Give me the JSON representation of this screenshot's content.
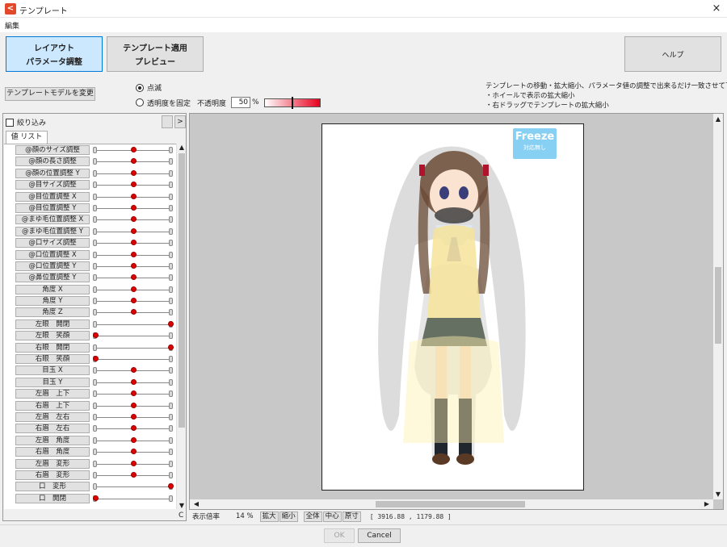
{
  "window": {
    "title": "テンプレート",
    "close": "×"
  },
  "menu": {
    "edit": "編集"
  },
  "toolbar": {
    "layout_line1": "レイアウト",
    "layout_line2": "パラメータ調整",
    "apply_line1": "テンプレート適用",
    "apply_line2": "プレビュー",
    "help": "ヘルプ",
    "change_model": "テンプレートモデルを変更",
    "blink_label": "点滅",
    "fix_opacity_label": "透明度を固定",
    "opacity_label": "不透明度",
    "opacity_value": "50",
    "opacity_unit": "%",
    "opacity_level": 0.5
  },
  "hints": [
    "テンプレートの移動・拡大縮小、パラメータ値の調整で出来るだけ一致させて下さい。",
    "・ホイールで表示の拡大縮小",
    "・右ドラッグでテンプレートの拡大縮小"
  ],
  "left_panel": {
    "filter_label": "絞り込み",
    "expand_btn": ">",
    "tab_label": "値 リスト",
    "corner_label": "C",
    "params": [
      {
        "label": "@顔のサイズ調整",
        "pos": 0.5
      },
      {
        "label": "@顔の長さ調整",
        "pos": 0.5
      },
      {
        "label": "@顔の位置調整 Y",
        "pos": 0.5
      },
      {
        "label": "@目サイズ調整",
        "pos": 0.5
      },
      {
        "label": "@目位置調整 X",
        "pos": 0.5
      },
      {
        "label": "@目位置調整 Y",
        "pos": 0.5
      },
      {
        "label": "@まゆ毛位置調整 X",
        "pos": 0.5
      },
      {
        "label": "@まゆ毛位置調整 Y",
        "pos": 0.5
      },
      {
        "label": "@口サイズ調整",
        "pos": 0.5
      },
      {
        "label": "@口位置調整 X",
        "pos": 0.5
      },
      {
        "label": "@口位置調整 Y",
        "pos": 0.5
      },
      {
        "label": "@鼻位置調整 Y",
        "pos": 0.5
      },
      {
        "label": "角度 X",
        "pos": 0.5
      },
      {
        "label": "角度 Y",
        "pos": 0.5
      },
      {
        "label": "角度 Z",
        "pos": 0.5
      },
      {
        "label": "左眼　開閉",
        "pos": 1.0
      },
      {
        "label": "左眼　笑顔",
        "pos": 0.0
      },
      {
        "label": "右眼　開閉",
        "pos": 1.0
      },
      {
        "label": "右眼　笑顔",
        "pos": 0.0
      },
      {
        "label": "目玉 X",
        "pos": 0.5
      },
      {
        "label": "目玉 Y",
        "pos": 0.5
      },
      {
        "label": "左眉　上下",
        "pos": 0.5
      },
      {
        "label": "右眉　上下",
        "pos": 0.5
      },
      {
        "label": "左眉　左右",
        "pos": 0.5
      },
      {
        "label": "右眉　左右",
        "pos": 0.5
      },
      {
        "label": "左眉　角度",
        "pos": 0.5
      },
      {
        "label": "右眉　角度",
        "pos": 0.5
      },
      {
        "label": "左眉　変形",
        "pos": 0.5
      },
      {
        "label": "右眉　変形",
        "pos": 0.5
      },
      {
        "label": "口　変形",
        "pos": 1.0
      },
      {
        "label": "口　開閉",
        "pos": 0.0
      }
    ]
  },
  "canvas": {
    "freeze_title": "Freeze",
    "freeze_sub": "対応無し"
  },
  "status": {
    "zoom_label": "表示倍率",
    "zoom_value": "14 %",
    "zoom_in": "拡大",
    "zoom_out": "縮小",
    "fit_all": "全体",
    "center": "中心",
    "original": "原寸",
    "coords": "[ 3916.88 , 1179.88 ]"
  },
  "footer": {
    "ok": "OK",
    "cancel": "Cancel"
  }
}
